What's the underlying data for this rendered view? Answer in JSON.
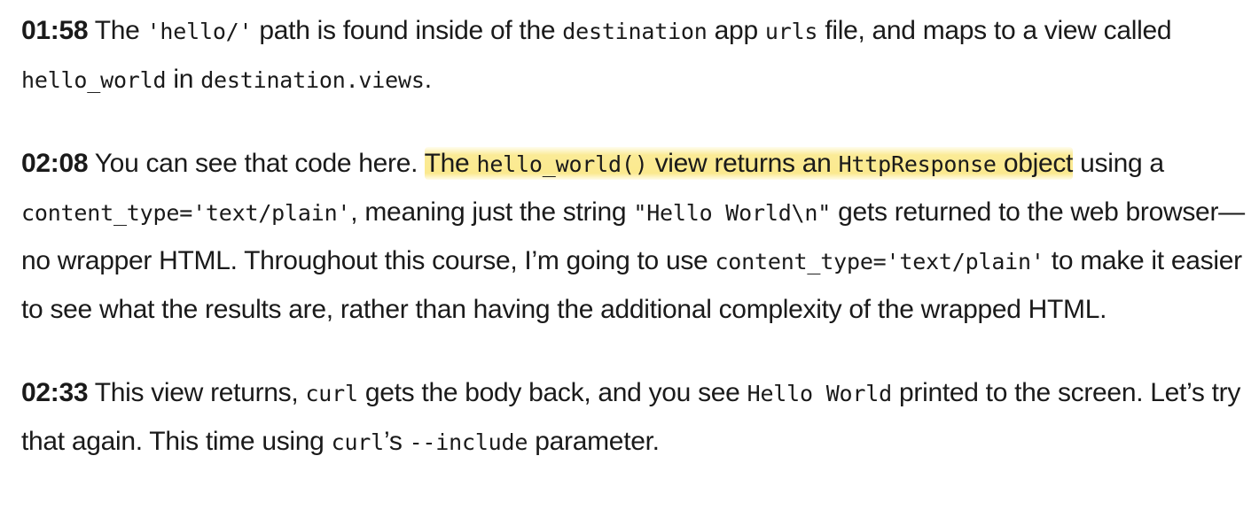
{
  "paragraphs": [
    {
      "timestamp": "01:58",
      "t1": " The ",
      "c1": "'hello/'",
      "t2": " path is found inside of the ",
      "c2": "destination",
      "t3": " app ",
      "c3": "urls",
      "t4": " file, and maps to a view called ",
      "c4": "hello_world",
      "t5": " in ",
      "c5": "destination.views",
      "t6": "."
    },
    {
      "timestamp": "02:08",
      "t1": " You can see that code here. ",
      "h1": "The ",
      "hc1": "hello_world()",
      "h2": " view returns an ",
      "hc2": "HttpResponse",
      "h3": " object",
      "t2": " using a ",
      "c1": "content_type='text/plain'",
      "t3": ", meaning just the string ",
      "c2": "\"Hello World\\n\"",
      "t4": " gets returned to the web browser—no wrapper HTML. Throughout this course, I’m going to use ",
      "c3": "content_type='text/plain'",
      "t5": " to make it easier to see what the results are, rather than having the additional complexity of the wrapped HTML.",
      "highlight_color": "#fbeb96"
    },
    {
      "timestamp": "02:33",
      "t1": " This view returns, ",
      "c1": "curl",
      "t2": " gets the body back, and you see ",
      "c2": "Hello World",
      "t3": " printed to the screen. Let’s try that again. This time using ",
      "c3": "curl",
      "t4": "’s ",
      "c4": "--include",
      "t5": " parameter."
    }
  ]
}
